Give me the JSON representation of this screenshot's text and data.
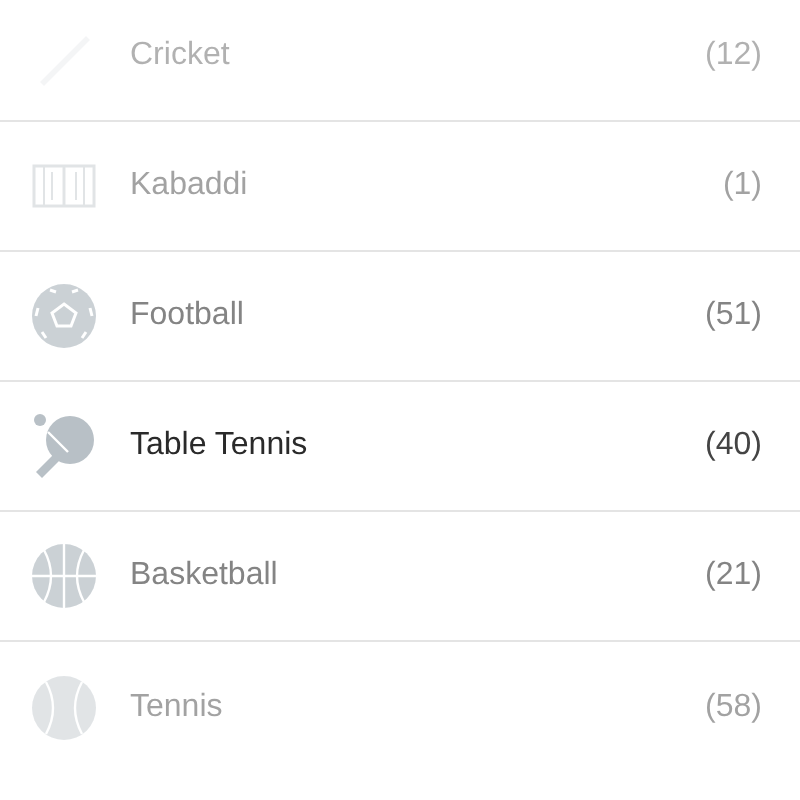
{
  "sports": [
    {
      "name": "Cricket",
      "count": "(12)",
      "kind": "bat",
      "selected": false
    },
    {
      "name": "Kabaddi",
      "count": "(1)",
      "kind": "court",
      "selected": false
    },
    {
      "name": "Football",
      "count": "(51)",
      "kind": "soccer",
      "selected": false
    },
    {
      "name": "Table Tennis",
      "count": "(40)",
      "kind": "paddle",
      "selected": true
    },
    {
      "name": "Basketball",
      "count": "(21)",
      "kind": "basket",
      "selected": false
    },
    {
      "name": "Tennis",
      "count": "(58)",
      "kind": "tennis",
      "selected": false
    }
  ]
}
